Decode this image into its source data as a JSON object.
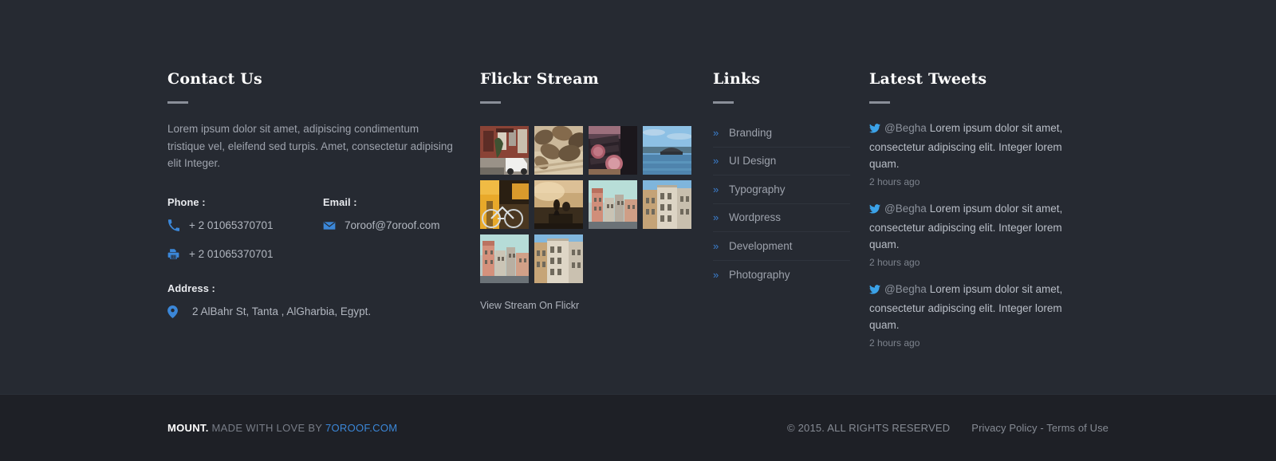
{
  "contact": {
    "title": "Contact Us",
    "description": "Lorem ipsum dolor sit amet, adipiscing condimentum tristique vel, eleifend sed turpis. Amet, consectetur adipising elit Integer.",
    "phone_label": "Phone :",
    "phone": "+ 2 01065370701",
    "fax": "+ 2 01065370701",
    "email_label": "Email :",
    "email": "7oroof@7oroof.com",
    "address_label": "Address :",
    "address": "2 AlBahr St, Tanta , AlGharbia, Egypt."
  },
  "flickr": {
    "title": "Flickr Stream",
    "link_label": "View Stream On Flickr",
    "thumbs": [
      {
        "alt": "red brick building with white car",
        "id": "thumb-1"
      },
      {
        "alt": "coffee beans close up",
        "id": "thumb-2"
      },
      {
        "alt": "drums in concert hall",
        "id": "thumb-3"
      },
      {
        "alt": "modern opera house by the water",
        "id": "thumb-4"
      },
      {
        "alt": "bicycle under golden lit arcade",
        "id": "thumb-5"
      },
      {
        "alt": "silhouette of person at sunset",
        "id": "thumb-6"
      },
      {
        "alt": "pastel town buildings",
        "id": "thumb-7"
      },
      {
        "alt": "beige apartment facade blue sky",
        "id": "thumb-8"
      },
      {
        "alt": "pastel town buildings",
        "id": "thumb-9"
      },
      {
        "alt": "beige apartment facade blue sky",
        "id": "thumb-10"
      }
    ]
  },
  "links": {
    "title": "Links",
    "items": [
      {
        "label": "Branding"
      },
      {
        "label": "UI Design"
      },
      {
        "label": "Typography"
      },
      {
        "label": "Wordpress"
      },
      {
        "label": "Development"
      },
      {
        "label": "Photography"
      }
    ]
  },
  "tweets": {
    "title": "Latest Tweets",
    "items": [
      {
        "handle": "@Begha",
        "text": "Lorem ipsum dolor sit amet, consectetur adipiscing elit. Integer lorem quam.",
        "time": "2 hours ago"
      },
      {
        "handle": "@Begha",
        "text": "Lorem ipsum dolor sit amet, consectetur adipiscing elit. Integer lorem quam.",
        "time": "2 hours ago"
      },
      {
        "handle": "@Begha",
        "text": "Lorem ipsum dolor sit amet, consectetur adipiscing elit. Integer lorem quam.",
        "time": "2 hours ago"
      }
    ]
  },
  "bottom": {
    "brand": "MOUNT.",
    "made_by": " MADE WITH LOVE BY ",
    "brand_link": "7OROOF.COM",
    "rights": "© 2015. ALL RIGHTS RESERVED",
    "policy": "Privacy Policy - Terms of Use"
  },
  "colors": {
    "footer_bg": "#262a32",
    "bottom_bg": "#1e2026",
    "accent": "#3b87d8",
    "twitter": "#3ba2e8",
    "muted_text": "#9ea3ad"
  }
}
